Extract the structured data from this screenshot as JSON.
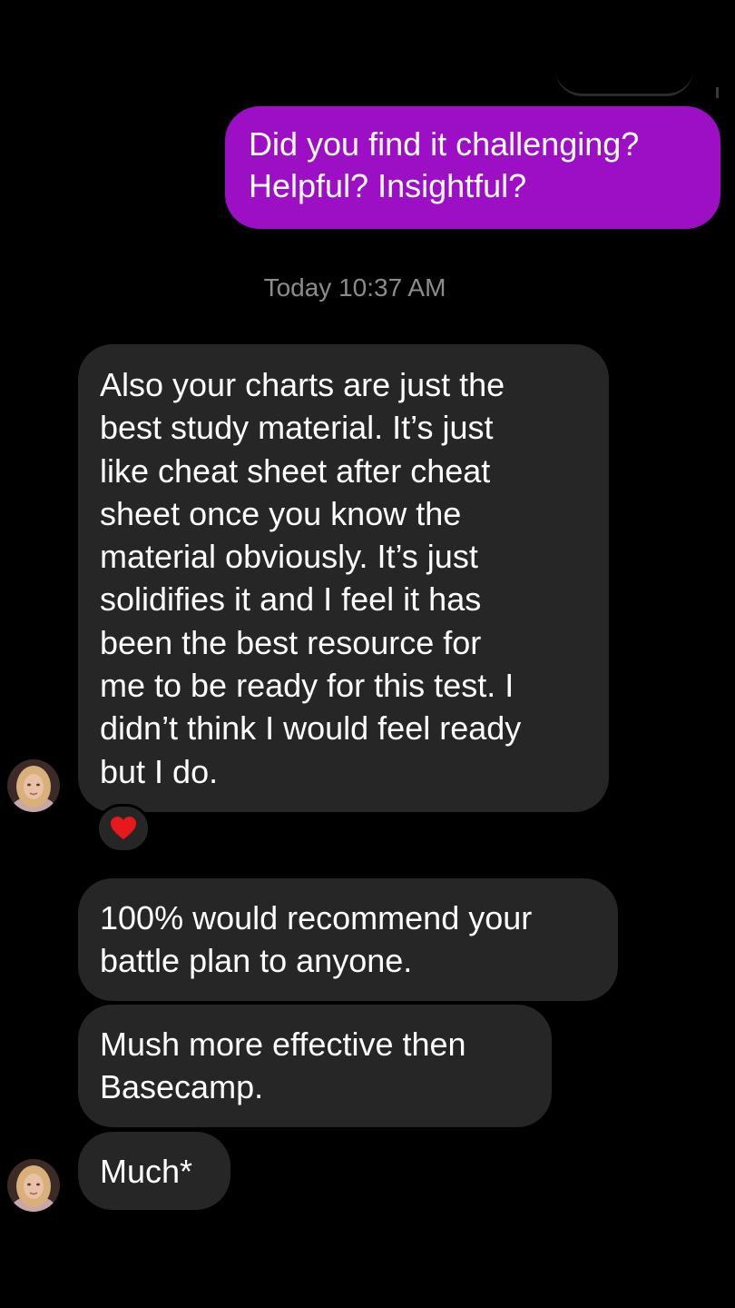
{
  "conversation": {
    "sent_messages": [
      {
        "text": "Did you find it challenging?\nHelpful? Insightful?"
      }
    ],
    "timestamp": "Today 10:37 AM",
    "received_messages": [
      {
        "text": "Also your charts are just the\nbest study material. It’s just\nlike cheat sheet after cheat\nsheet once you know the\nmaterial obviously. It’s just\nsolidifies it and I feel it has\nbeen the best resource for\nme to be ready for this test. I\ndidn’t think I would feel ready\nbut I do."
      },
      {
        "text": "100% would recommend your\nbattle plan to anyone."
      },
      {
        "text": "Mush more effective then\nBasecamp."
      },
      {
        "text": "Much*"
      }
    ],
    "reaction": {
      "icon": "heart-icon",
      "color": "#e8191c"
    }
  },
  "colors": {
    "background": "#000000",
    "sent_bubble": "#9c0fc4",
    "received_bubble": "#262626",
    "timestamp_text": "#8c8c8c"
  }
}
